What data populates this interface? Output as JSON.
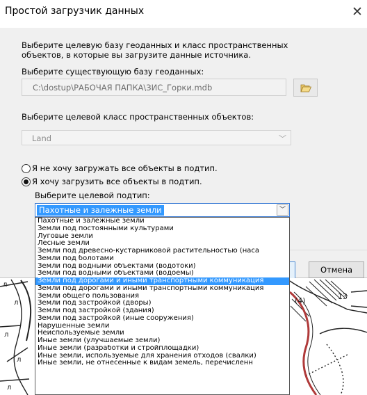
{
  "dialog": {
    "title": "Простой загрузчик данных",
    "close_glyph": "✕",
    "instruction": "Выберите целевую базу геоданных и класс пространственных объектов, в которые вы загрузите данные источника.",
    "geodatabase": {
      "label": "Выберите существующую базу геоданных:",
      "value": "C:\\dostup\\РАБОЧАЯ ПАПКА\\ЗИС_Горки.mdb",
      "browse_icon": "folder-open-icon"
    },
    "feature_class": {
      "label": "Выберите целевой класс пространственных объектов:",
      "value": "Land"
    },
    "radio_all_no": "Я не хочу загружать все объекты в подтип.",
    "radio_all_yes": "Я хочу загрузить все объекты в подтип.",
    "subtype": {
      "label": "Выберите целевой подтип:",
      "selected": "Пахотные и залежные земли",
      "options": [
        "Пахотные и залежные земли",
        "Земли под постоянными культурами",
        "Луговые земли",
        "Лесные земли",
        "Земли под древесно-кустарниковой растительностью (наса",
        "Земли под болотами",
        "Земли под водными объектами (водотоки)",
        "Земли под водными объектами (водоемы)",
        "Земли под дорогами и иными транспортными коммуникация",
        "Земли под дорогами и иными транспортными коммуникация",
        "Земли общего пользования",
        "Земли под застройкой (дворы)",
        "Земли под застройкой (здания)",
        "Земли под застройкой (иные сооружения)",
        "Нарушенные земли",
        "Неиспользуемые земли",
        "Иные земли (улучшаемые земли)",
        "Иные земли (разработки и стройплощадки)",
        "Иные земли, используемые для хранения отходов (свалки)",
        "Иные земли, не отнесенные к видам земель, перечисленн"
      ],
      "highlighted_index": 8
    },
    "cancel_label": "Отмена"
  },
  "map": {
    "labels": [
      "л",
      "л",
      "л",
      "л",
      "л",
      "(4)",
      "13"
    ],
    "colors": {
      "road": "#b03a3a",
      "hatch": "#222222"
    }
  }
}
